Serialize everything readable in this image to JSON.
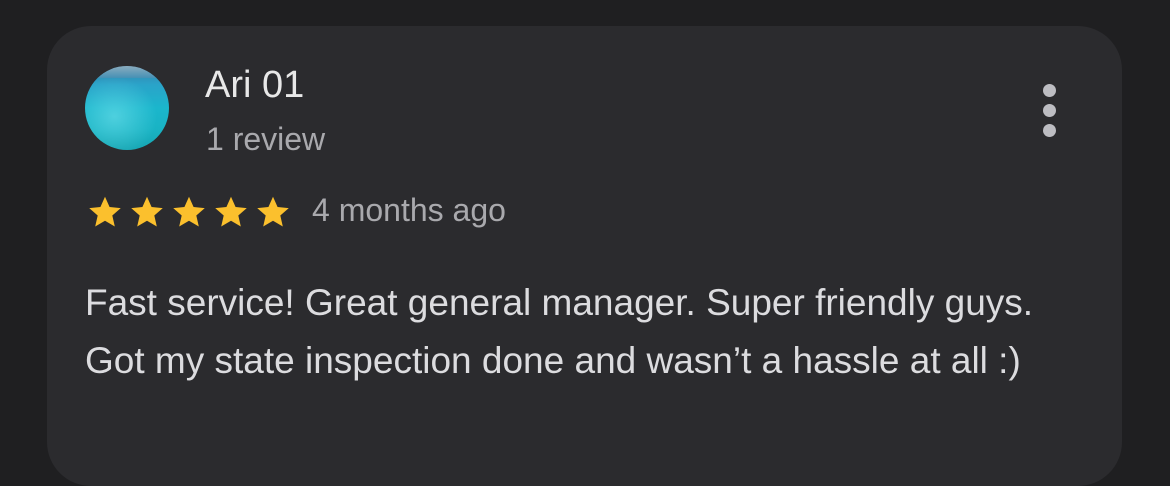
{
  "review": {
    "author_name": "Ari 01",
    "review_count": "1 review",
    "rating": 5,
    "rating_max": 5,
    "time_ago": "4 months ago",
    "text": "Fast service! Great general manager. Super friendly guys. Got my state inspection done and wasn’t a hassle at all :)",
    "star_color": "#fbc02d",
    "more_icon": "more-vert-icon"
  },
  "colors": {
    "background": "#1f1f21",
    "card": "#2b2b2e",
    "primary_text": "#e8e8e8",
    "secondary_text": "#a9a9ad"
  }
}
